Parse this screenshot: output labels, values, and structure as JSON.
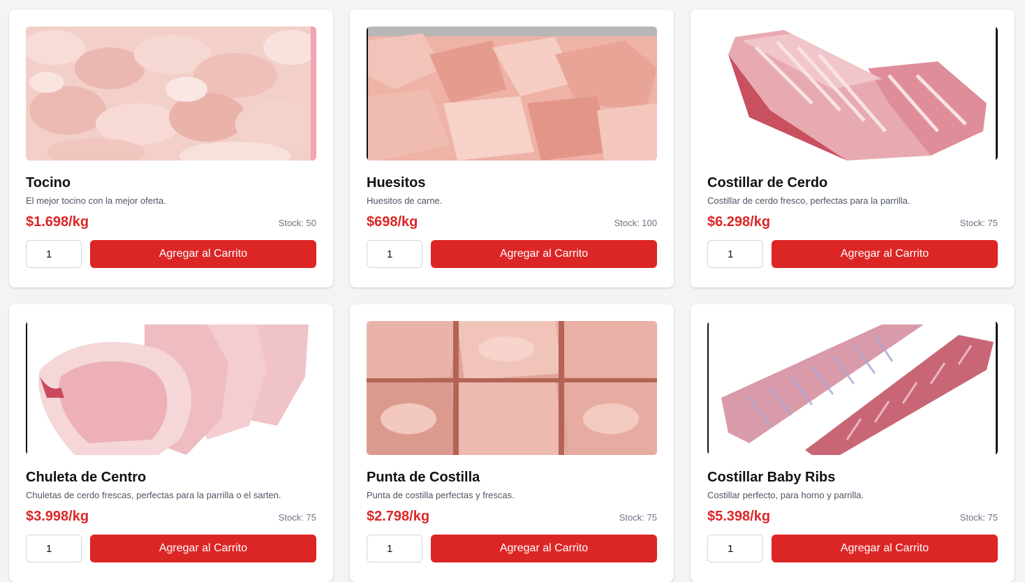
{
  "products": [
    {
      "name": "Tocino",
      "description": "El mejor tocino con la mejor oferta.",
      "price": "$1.698/kg",
      "stock": "Stock: 50",
      "quantity": "1",
      "button_label": "Agregar al Carrito",
      "image_icon": "bacon-image"
    },
    {
      "name": "Huesitos",
      "description": "Huesitos de carne.",
      "price": "$698/kg",
      "stock": "Stock: 100",
      "quantity": "1",
      "button_label": "Agregar al Carrito",
      "image_icon": "bones-image"
    },
    {
      "name": "Costillar de Cerdo",
      "description": "Costillar de cerdo fresco, perfectas para la parrilla.",
      "price": "$6.298/kg",
      "stock": "Stock: 75",
      "quantity": "1",
      "button_label": "Agregar al Carrito",
      "image_icon": "pork-ribs-image"
    },
    {
      "name": "Chuleta de Centro",
      "description": "Chuletas de cerdo frescas, perfectas para la parrilla o el sarten.",
      "price": "$3.998/kg",
      "stock": "Stock: 75",
      "quantity": "1",
      "button_label": "Agregar al Carrito",
      "image_icon": "pork-chops-image"
    },
    {
      "name": "Punta de Costilla",
      "description": "Punta de costilla perfectas y frescas.",
      "price": "$2.798/kg",
      "stock": "Stock: 75",
      "quantity": "1",
      "button_label": "Agregar al Carrito",
      "image_icon": "rib-tips-image"
    },
    {
      "name": "Costillar Baby Ribs",
      "description": "Costillar perfecto, para horno y parrilla.",
      "price": "$5.398/kg",
      "stock": "Stock: 75",
      "quantity": "1",
      "button_label": "Agregar al Carrito",
      "image_icon": "baby-ribs-image"
    }
  ],
  "colors": {
    "accent": "#dc2626",
    "background": "#f3f4f6",
    "card": "#ffffff"
  }
}
